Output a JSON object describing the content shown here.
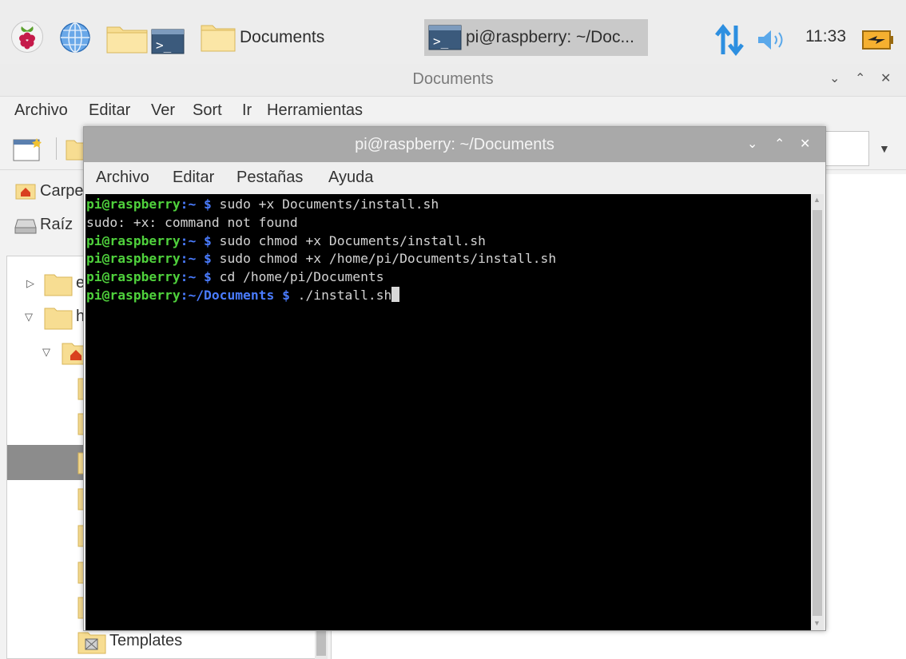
{
  "taskbar": {
    "apps": [
      {
        "name": "raspberry-menu"
      },
      {
        "name": "web-browser"
      },
      {
        "name": "file-manager"
      },
      {
        "name": "terminal"
      }
    ],
    "tasks": [
      {
        "label": "Documents",
        "icon": "folder-icon"
      },
      {
        "label": "pi@raspberry: ~/Doc...",
        "icon": "terminal-icon"
      }
    ],
    "clock": "11:33",
    "colors": {
      "folder": "#f5d88a",
      "network": "#2d8fe0",
      "battery": "#f0a020"
    }
  },
  "file_manager": {
    "title": "Documents",
    "menu": [
      "Archivo",
      "Editar",
      "Ver",
      "Sort",
      "Ir",
      "Herramientas"
    ],
    "places": [
      {
        "label": "Carpe",
        "icon": "home-icon"
      },
      {
        "label": "Raíz",
        "icon": "drive-icon"
      }
    ],
    "tree": [
      {
        "label": "e",
        "expander": "▷"
      },
      {
        "label": "h",
        "expander": "▽"
      },
      {
        "label": "",
        "expander": "▽"
      },
      {
        "label": "Templates",
        "expander": ""
      }
    ]
  },
  "terminal": {
    "title": "pi@raspberry: ~/Documents",
    "menu": [
      "Archivo",
      "Editar",
      "Pestañas",
      "Ayuda"
    ],
    "lines": [
      {
        "user": "pi@raspberry",
        "path": ":~ $",
        "cmd": " sudo +x Documents/install.sh"
      },
      {
        "output": "sudo: +x: command not found"
      },
      {
        "user": "pi@raspberry",
        "path": ":~ $",
        "cmd": " sudo chmod +x Documents/install.sh"
      },
      {
        "user": "pi@raspberry",
        "path": ":~ $",
        "cmd": " sudo chmod +x /home/pi/Documents/install.sh"
      },
      {
        "user": "pi@raspberry",
        "path": ":~ $",
        "cmd": " cd /home/pi/Documents"
      },
      {
        "user": "pi@raspberry",
        "path": ":~/Documents $",
        "cmd": " ./install.sh"
      }
    ],
    "colors": {
      "user": "#4fd13c",
      "path": "#4a7cff",
      "background": "#000000"
    }
  }
}
